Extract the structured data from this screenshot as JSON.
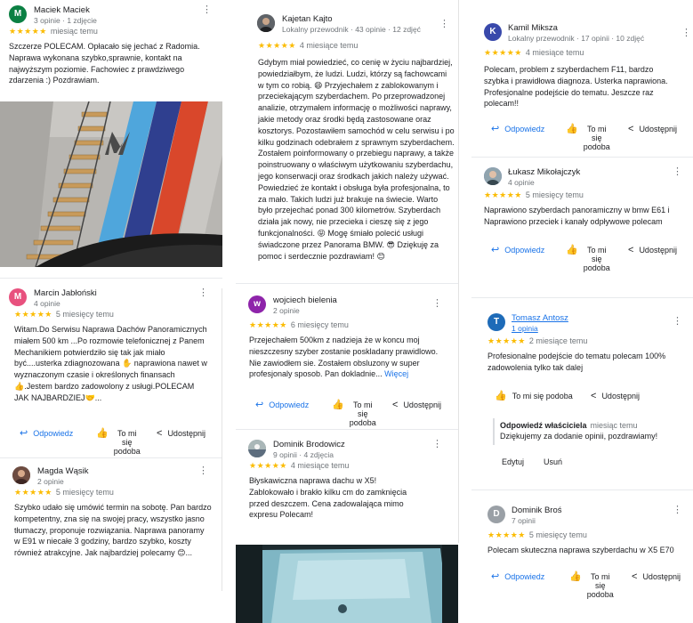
{
  "actions": {
    "reply": "Odpowiedz",
    "like_line1": "To mi",
    "like_line2": "się",
    "like_line3": "podoba",
    "share": "Udostępnij",
    "like_single": "To mi się podoba"
  },
  "reviews": {
    "maciek": {
      "name": "Maciek Maciek",
      "meta": "3 opinie · 1 zdjęcie",
      "avatar_letter": "M",
      "avatar_color": "#0b8043",
      "stars": "★★★★★",
      "date": "miesiąc temu",
      "text": "Szczerze POLECAM. Opłacało się jechać z Radomia. Naprawa wykonana szybko,sprawnie, kontakt na najwyższym poziomie. Fachowiec z prawdziwego zdarzenia :) Pozdrawiam."
    },
    "marcin": {
      "name": "Marcin Jabłoński",
      "meta": "4 opinie",
      "avatar_letter": "M",
      "avatar_color": "#e8517e",
      "stars": "★★★★★",
      "date": "5 miesięcy temu",
      "text": "Witam.Do Serwisu Naprawa Dachów Panoramicznych miałem 500 km ...Po rozmowie telefonicznej z Panem Mechanikiem potwierdziło się tak jak miało być....usterka zdiagnozowana ✋ naprawiona nawet w wyznaczonym czasie i określonych finansach 👍.Jestem bardzo zadowolony z usługi.POLECAM JAK NAJBARDZIEJ🤝..."
    },
    "magda": {
      "name": "Magda Wąsik",
      "meta": "2 opinie",
      "avatar_color": "#6d4c41",
      "stars": "★★★★★",
      "date": "5 miesięcy temu",
      "text": "Szybko udało się umówić termin na sobotę. Pan bardzo kompetentny, zna się na swojej pracy, wszystko jasno tłumaczy, proponuje rozwiązania. Naprawa panoramy w E91 w niecałe 3 godziny, bardzo szybko, koszty również atrakcyjne. Jak najbardziej polecamy 😊..."
    },
    "kajetan": {
      "name": "Kajetan Kajto",
      "meta": "Lokalny przewodnik · 43 opinie · 12 zdjęć",
      "avatar_color": "#3c4043",
      "stars": "★★★★★",
      "date": "4 miesiące temu",
      "text": "Gdybym miał powiedzieć, co cenię w życiu najbardziej, powiedziałbym, że ludzi. Ludzi, którzy są fachowcami w tym co robią. 😄 Przyjechałem z zablokowanym i przeciekającym szyberdachem. Po przeprowadzonej analizie, otrzymałem informację o możliwości naprawy, jakie metody oraz środki będą zastosowane oraz kosztorys. Pozostawiłem samochód w celu serwisu i po kilku godzinach odebrałem z sprawnym szyberdachem. Zostałem poinformowany o przebiegu naprawy, a także poinstruowany o właściwym użytkowaniu szyberdachu, jego konserwacji oraz środkach jakich należy używać. Powiedzieć że kontakt i obsługa była profesjonalna, to za mało. Takich ludzi już brakuje na świecie. Warto było przejechać ponad 300 kilometrów. Szyberdach działa jak nowy, nie przecieka i cieszę się z jego funkcjonalności. 😝 Mogę śmiało polecić usługi świadczone przez Panorama BMW. 😎 Dziękuję za pomoc i serdecznie pozdrawiam! 😊"
    },
    "wojciech": {
      "name": "wojciech bielenia",
      "meta": "2 opinie",
      "avatar_letter": "w",
      "avatar_color": "#8e24aa",
      "stars": "★★★★★",
      "date": "6 miesięcy temu",
      "text": "Przejechałem 500km z nadzieja że w koncu moj nieszczesny szyber zostanie poskladany prawidlowo. Nie zawiodłem sie. Zostałem obsluzony w super profesjonaly sposob. Pan dokladnie...",
      "more": "Więcej"
    },
    "dominik_brodowicz": {
      "name": "Dominik Brodowicz",
      "meta": "9 opinii · 4 zdjęcia",
      "avatar_color": "#7f8c8d",
      "stars": "★★★★★",
      "date": "4 miesiące temu",
      "text": "Błyskawiczna naprawa dachu w X5! Zablokowało i brakło kilku cm do zamknięcia przed deszczem. Cena zadowalająca mimo expresu Polecam!"
    },
    "kamil": {
      "name": "Kamil Miksza",
      "meta": "Lokalny przewodnik · 17 opinii · 10 zdjęć",
      "avatar_letter": "K",
      "avatar_color": "#3949ab",
      "stars": "★★★★★",
      "date": "4 miesiące temu",
      "text": "Polecam, problem z szyberdachem F11, bardzo szybka i prawidłowa diagnoza. Usterka naprawiona. Profesjonalne podejście do tematu. Jeszcze raz polecam!!"
    },
    "lukasz": {
      "name": "Łukasz Mikołajczyk",
      "meta": "4 opinie",
      "avatar_color": "#5c6bc0",
      "stars": "★★★★★",
      "date": "5 miesięcy temu",
      "text": "Naprawiono szyberdach panoramiczny w bmw E61 i Naprawiono przeciek i kanały odpływowe polecam"
    },
    "tomasz": {
      "name": "Tomasz Antosz",
      "meta": "1 opinia",
      "avatar_letter": "T",
      "avatar_color": "#1e6bb8",
      "stars": "★★★★★",
      "date": "2 miesiące temu",
      "text": "Profesionalne podejście do tematu polecam 100% zadowolenia tylko tak dalej",
      "owner_title": "Odpowiedź właściciela",
      "owner_date": "miesiąc temu",
      "owner_text": "Dziękujemy za dodanie opinii, pozdrawiamy!",
      "owner_edit": "Edytuj",
      "owner_delete": "Usuń"
    },
    "dominik_bros": {
      "name": "Dominik Broś",
      "meta": "7 opinii",
      "avatar_letter": "D",
      "avatar_color": "#9aa0a6",
      "stars": "★★★★★",
      "date": "5 miesięcy temu",
      "text": "Polecam skuteczna naprawa szyberdachu w X5 E70"
    }
  },
  "icons": {
    "more": "more-vert-icon",
    "reply": "reply-arrow-icon",
    "like": "thumb-up-icon",
    "share": "share-icon"
  },
  "colors": {
    "star": "#fbbc04",
    "link": "#1a73e8",
    "bmw_light_blue": "#4fa6dc",
    "bmw_dark_blue": "#2f3f8f",
    "bmw_red": "#d9472b"
  }
}
